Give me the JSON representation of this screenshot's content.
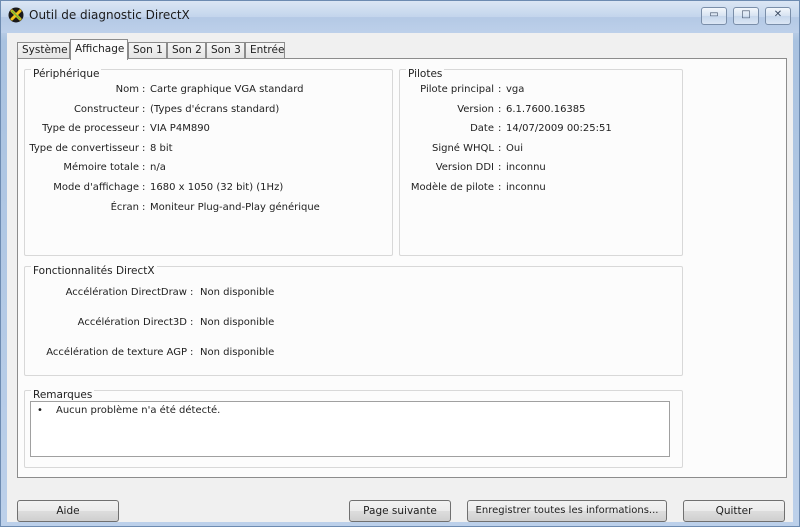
{
  "window": {
    "title": "Outil de diagnostic DirectX",
    "minimize_glyph": "▭",
    "maximize_glyph": "□",
    "close_glyph": "✕"
  },
  "tabs": [
    {
      "label": "Système"
    },
    {
      "label": "Affichage"
    },
    {
      "label": "Son 1"
    },
    {
      "label": "Son 2"
    },
    {
      "label": "Son 3"
    },
    {
      "label": "Entrée"
    }
  ],
  "device": {
    "title": "Périphérique",
    "rows": [
      {
        "label": "Nom",
        "value": "Carte graphique VGA standard"
      },
      {
        "label": "Constructeur",
        "value": "(Types d'écrans standard)"
      },
      {
        "label": "Type de processeur",
        "value": "VIA P4M890"
      },
      {
        "label": "Type de convertisseur",
        "value": "8 bit"
      },
      {
        "label": "Mémoire totale",
        "value": "n/a"
      },
      {
        "label": "Mode d'affichage",
        "value": "1680 x 1050 (32 bit) (1Hz)"
      },
      {
        "label": "Écran",
        "value": "Moniteur Plug-and-Play générique"
      }
    ]
  },
  "drivers": {
    "title": "Pilotes",
    "rows": [
      {
        "label": "Pilote principal",
        "value": "vga"
      },
      {
        "label": "Version",
        "value": "6.1.7600.16385"
      },
      {
        "label": "Date",
        "value": "14/07/2009 00:25:51"
      },
      {
        "label": "Signé WHQL",
        "value": "Oui"
      },
      {
        "label": "Version DDI",
        "value": "inconnu"
      },
      {
        "label": "Modèle de pilote",
        "value": "inconnu"
      }
    ]
  },
  "features": {
    "title": "Fonctionnalités DirectX",
    "rows": [
      {
        "label": "Accélération DirectDraw",
        "value": "Non disponible"
      },
      {
        "label": "Accélération Direct3D",
        "value": "Non disponible"
      },
      {
        "label": "Accélération de texture AGP",
        "value": "Non disponible"
      }
    ]
  },
  "notes": {
    "title": "Remarques",
    "bullet": "•",
    "text": "Aucun problème n'a été détecté."
  },
  "separator": ":",
  "buttons": {
    "help": "Aide",
    "next_page": "Page suivante",
    "save_all": "Enregistrer toutes les informations...",
    "quit": "Quitter"
  },
  "colors": {
    "title_bar": "#c3d5ec",
    "panel_bg": "#fcfcfc",
    "client_bg": "#f0f0f0"
  }
}
